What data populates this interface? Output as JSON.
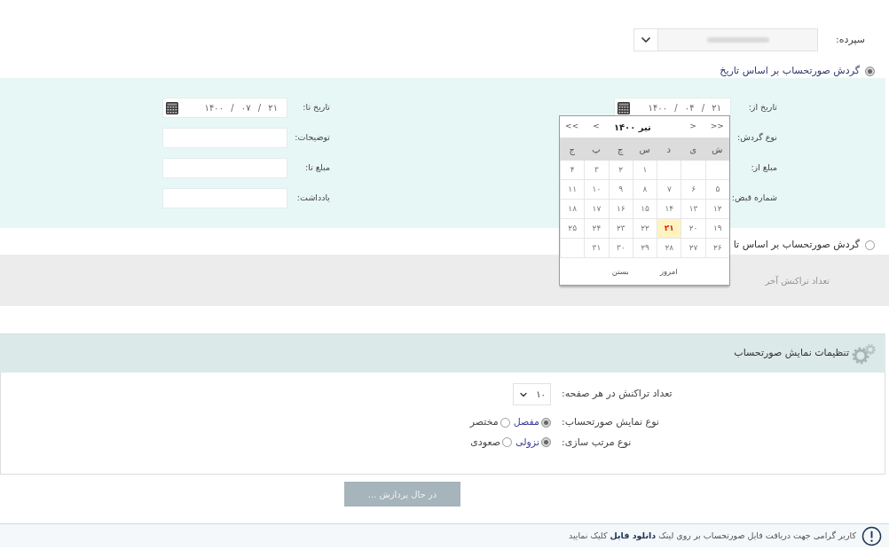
{
  "deposit": {
    "label": "سپرده:"
  },
  "date_section": {
    "option": {
      "label": "گردش صورتحساب بر اساس تاریخ",
      "selected": true
    },
    "right_fields": [
      {
        "label": "تاریخ از:",
        "kind": "date",
        "value": "۱۴۰۰ / ۰۴ / ۲۱"
      },
      {
        "label": "نوع گردش:"
      },
      {
        "label": "مبلغ از:"
      },
      {
        "label": "شماره قبض:"
      }
    ],
    "left_fields": [
      {
        "label": "تاریخ تا:",
        "kind": "date",
        "value": "۱۴۰۰ / ۰۷ / ۲۱"
      },
      {
        "label": "توضیحات:",
        "kind": "text"
      },
      {
        "label": "مبلغ تا:",
        "kind": "text"
      },
      {
        "label": "یادداشت:",
        "kind": "text"
      }
    ]
  },
  "calendar": {
    "nav_right": [
      ">>",
      ">"
    ],
    "title": "تیر ۱۴۰۰",
    "nav_left": [
      "<",
      "<<"
    ],
    "weekdays": [
      "ش",
      "ی",
      "د",
      "س",
      "چ",
      "پ",
      "ج"
    ],
    "weeks": [
      [
        {
          "kind": "blank"
        },
        {
          "kind": "blank"
        },
        {
          "kind": "blank"
        },
        {
          "kind": "day",
          "label": "۱",
          "selected": false
        },
        {
          "kind": "day",
          "label": "۲",
          "selected": false
        },
        {
          "kind": "day",
          "label": "۳",
          "selected": false
        },
        {
          "kind": "day",
          "label": "۴",
          "selected": false
        }
      ],
      [
        {
          "kind": "day",
          "label": "۵",
          "selected": false
        },
        {
          "kind": "day",
          "label": "۶",
          "selected": false
        },
        {
          "kind": "day",
          "label": "۷",
          "selected": false
        },
        {
          "kind": "day",
          "label": "۸",
          "selected": false
        },
        {
          "kind": "day",
          "label": "۹",
          "selected": false
        },
        {
          "kind": "day",
          "label": "۱۰",
          "selected": false
        },
        {
          "kind": "day",
          "label": "۱۱",
          "selected": false
        }
      ],
      [
        {
          "kind": "day",
          "label": "۱۲",
          "selected": false
        },
        {
          "kind": "day",
          "label": "۱۳",
          "selected": false
        },
        {
          "kind": "day",
          "label": "۱۴",
          "selected": false
        },
        {
          "kind": "day",
          "label": "۱۵",
          "selected": false
        },
        {
          "kind": "day",
          "label": "۱۶",
          "selected": false
        },
        {
          "kind": "day",
          "label": "۱۷",
          "selected": false
        },
        {
          "kind": "day",
          "label": "۱۸",
          "selected": false
        }
      ],
      [
        {
          "kind": "day",
          "label": "۱۹",
          "selected": false
        },
        {
          "kind": "day",
          "label": "۲۰",
          "selected": false
        },
        {
          "kind": "day",
          "label": "۲۱",
          "selected": true
        },
        {
          "kind": "day",
          "label": "۲۲",
          "selected": false
        },
        {
          "kind": "day",
          "label": "۲۳",
          "selected": false
        },
        {
          "kind": "day",
          "label": "۲۴",
          "selected": false
        },
        {
          "kind": "day",
          "label": "۲۵",
          "selected": false
        }
      ],
      [
        {
          "kind": "day",
          "label": "۲۶",
          "selected": false
        },
        {
          "kind": "day",
          "label": "۲۷",
          "selected": false
        },
        {
          "kind": "day",
          "label": "۲۸",
          "selected": false
        },
        {
          "kind": "day",
          "label": "۲۹",
          "selected": false
        },
        {
          "kind": "day",
          "label": "۳۰",
          "selected": false
        },
        {
          "kind": "day",
          "label": "۳۱",
          "selected": false
        },
        {
          "kind": "blank"
        }
      ]
    ],
    "today": "امروز",
    "close": "بستن"
  },
  "count_section": {
    "option": {
      "label": "گردش صورتحساب بر اساس تا",
      "selected": false
    },
    "fields": [
      {
        "label": "تعداد تراکنش آخر",
        "disabled": true
      }
    ]
  },
  "settings": {
    "title": "تنظیمات نمایش صورتحساب",
    "rows": [
      {
        "kind": "select",
        "label": "تعداد تراکنش در هر صفحه:",
        "value": "۱۰"
      },
      {
        "kind": "radio",
        "label": "نوع نمایش صورتحساب:",
        "options": [
          {
            "label": "مفصل",
            "selected": true
          },
          {
            "label": "مختصر",
            "selected": false
          }
        ]
      },
      {
        "kind": "radio",
        "label": "نوع مرتب سازی:",
        "options": [
          {
            "label": "نزولی",
            "selected": true
          },
          {
            "label": "صعودی",
            "selected": false
          }
        ]
      }
    ]
  },
  "submit_button": {
    "label": "در حال پردازش ...",
    "disabled": true
  },
  "notice": {
    "text_before": "کاربر گرامی جهت دریافت فایل صورتحساب بر روی لینک",
    "link": "دانلود فایل",
    "text_after": "کلیک نمایید"
  }
}
